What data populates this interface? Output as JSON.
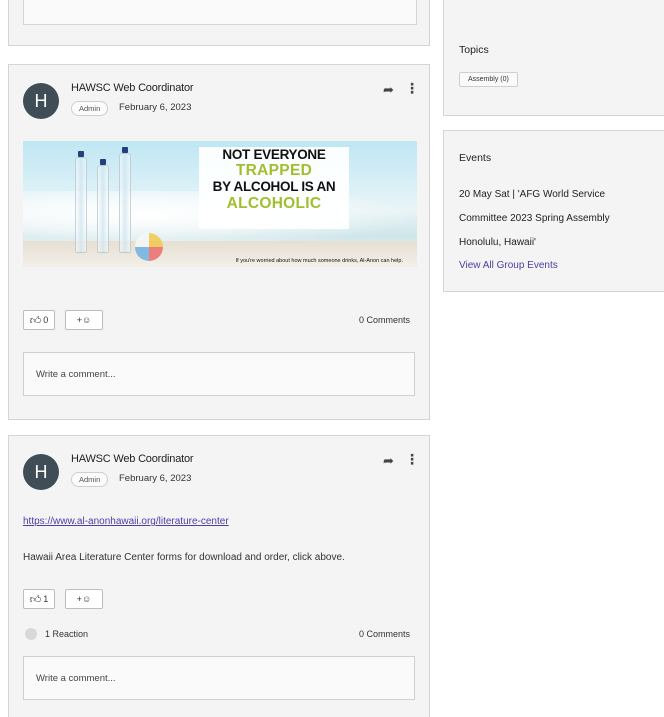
{
  "posts": [
    {
      "author": "HAWSC Web Coordinator",
      "role": "Admin",
      "date": "February 6, 2023",
      "avatar_letter": "H",
      "banner": {
        "line1": "NOT EVERYONE",
        "line2": "TRAPPED",
        "line3": "BY ALCOHOL IS AN",
        "line4": "ALCOHOLIC",
        "caption": "If you're worried about how much someone drinks, Al-Anon can help."
      },
      "like_count": "0",
      "add_reaction": "+☺",
      "comments": "0 Comments",
      "comment_placeholder": "Write a comment..."
    },
    {
      "author": "HAWSC Web Coordinator",
      "role": "Admin",
      "date": "February 6, 2023",
      "avatar_letter": "H",
      "link": "https://www.al-anonhawaii.org/literature-center",
      "body": "Hawaii Area Literature Center forms for download and order, click above.",
      "like_count": "1",
      "add_reaction": "+☺",
      "reactions": "1 Reaction",
      "comments": "0 Comments",
      "comment_placeholder": "Write a comment..."
    }
  ],
  "sidebar": {
    "topics": {
      "title": "Topics",
      "chips": [
        "Assembly (0)"
      ]
    },
    "events": {
      "title": "Events",
      "lines": [
        "20 May Sat | 'AFG World Service",
        "Committee 2023 Spring Assembly",
        "Honolulu, Hawaii'"
      ],
      "view_all": "View All Group Events"
    }
  },
  "colors": {
    "accent_link": "#4b3fa3",
    "avatar_bg": "#3f4d57",
    "banner_green": "#9fbf2f"
  }
}
